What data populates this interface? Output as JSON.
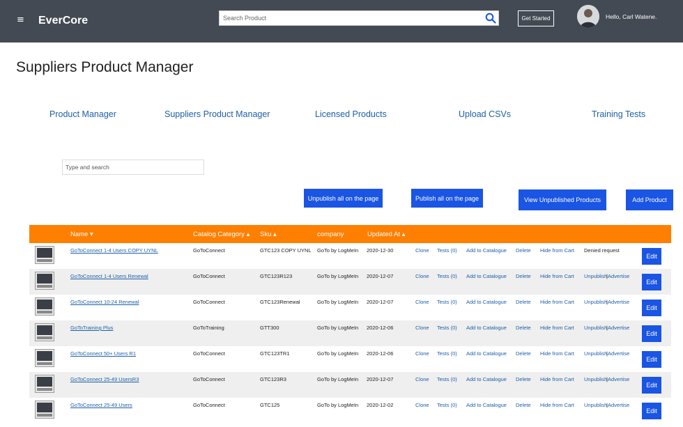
{
  "header": {
    "menu_glyph": "≡",
    "brand": "EverCore",
    "search_placeholder": "Search Product",
    "get_started": "Get Started",
    "greeting": "Hello, Carl Watene."
  },
  "page": {
    "title": "Suppliers Product Manager"
  },
  "nav": [
    "Product Manager",
    "Suppliers Product Manager",
    "Licensed Products",
    "Upload CSVs",
    "Training Tests"
  ],
  "filter": {
    "placeholder": "Type and search"
  },
  "actions": {
    "unpublish_all": "Unpublish all on the page",
    "publish_all": "Publish all on the page",
    "view_unpublished": "View Unpublished Products",
    "add_product": "Add Product"
  },
  "table": {
    "headers": {
      "name": "Name ▾",
      "category": "Catalog Category ▴",
      "sku": "Sku ▴",
      "company": "company",
      "updated": "Updated At ▴"
    },
    "row_actions": {
      "clone": "Clone",
      "tests": "Tests (0)",
      "add_catalogue": "Add to Catalogue",
      "delete": "Delete",
      "hide_cart": "Hide from Cart",
      "unpublish": "Unpublish",
      "advertise": "Advertise",
      "edit": "Edit"
    },
    "rows": [
      {
        "name": "GoToConnect 1-4 Users COPY UYNL",
        "category": "GoToConnect",
        "sku": "GTC123 COPY UYNL",
        "company": "GoTo by LogMeIn",
        "updated": "2020-12-30",
        "status": "Denied request"
      },
      {
        "name": "GoToConnect 1-4 Users Renewal",
        "category": "GoToConnect",
        "sku": "GTC123R123",
        "company": "GoTo by LogMeIn",
        "updated": "2020-12-07",
        "status": ""
      },
      {
        "name": "GoToConnect 10-24 Renewal",
        "category": "GoToConnect",
        "sku": "GTC123Renewal",
        "company": "GoTo by LogMeIn",
        "updated": "2020-12-07",
        "status": ""
      },
      {
        "name": "GoToTraining Plus",
        "category": "GoToTraining",
        "sku": "GTT300",
        "company": "GoTo by LogMeIn",
        "updated": "2020-12-06",
        "status": ""
      },
      {
        "name": "GoToConnect 50+ Users R1",
        "category": "GoToConnect",
        "sku": "GTC123TR1",
        "company": "GoTo by LogMeIn",
        "updated": "2020-12-06",
        "status": ""
      },
      {
        "name": "GoToConnect 25-49 UsersR3",
        "category": "GoToConnect",
        "sku": "GTC123R3",
        "company": "GoTo by LogMeIn",
        "updated": "2020-12-07",
        "status": ""
      },
      {
        "name": "GoToConnect 25-49 Users",
        "category": "GoToConnect",
        "sku": "GTC125",
        "company": "GoTo by LogMeIn",
        "updated": "2020-12-02",
        "status": ""
      }
    ]
  }
}
